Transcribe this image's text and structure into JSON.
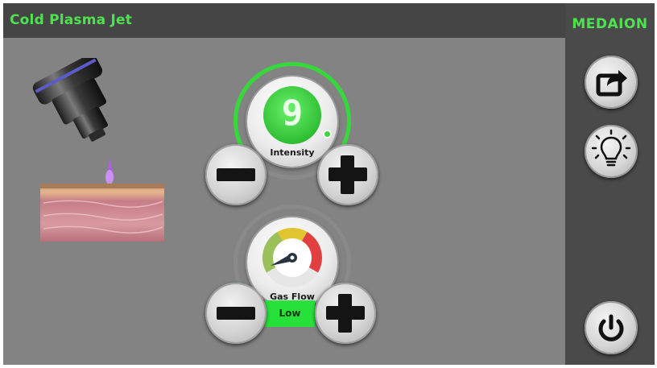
{
  "app": {
    "title": "Cold Plasma Jet",
    "brand": "MEDAION"
  },
  "colors": {
    "accent_green": "#4fe24f",
    "panel_gray": "#848384",
    "bar_dark": "#464546",
    "status_green": "#27e03a"
  },
  "intensity": {
    "label": "Intensity",
    "value": "9"
  },
  "gas_flow": {
    "label": "Gas Flow",
    "level": "Low"
  },
  "sidebar": {
    "export_icon": "share-export-icon",
    "light_icon": "light-bulb-icon",
    "power_icon": "power-icon"
  }
}
